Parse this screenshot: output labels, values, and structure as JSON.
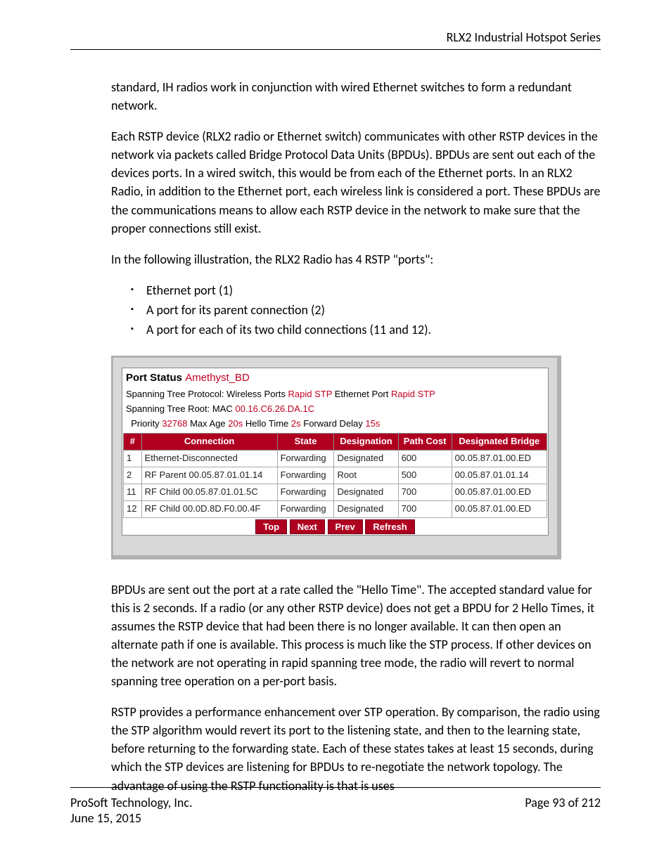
{
  "header": {
    "title": "RLX2 Industrial Hotspot Series"
  },
  "body": {
    "p1": "standard, IH radios work in conjunction with wired Ethernet switches to form a redundant network.",
    "p2": "Each RSTP device (RLX2 radio or Ethernet switch) communicates with other RSTP devices in the network via packets called Bridge Protocol Data Units (BPDUs).  BPDUs are sent out each of the devices ports.  In a wired switch, this would be from each of the Ethernet ports.  In an RLX2 Radio, in addition to the Ethernet port, each wireless link is considered a port.  These BPDUs are the communications means to allow each RSTP device in the network to make sure that the proper connections still exist.",
    "p3": "In the following illustration, the RLX2 Radio has 4 RSTP \"ports\":",
    "bullets": [
      "Ethernet port (1)",
      "A port for its parent connection (2)",
      "A port for each of its two child connections (11 and 12)."
    ],
    "p4": "BPDUs are sent out the port at a rate called the \"Hello Time\". The accepted standard value for this is 2 seconds. If a radio (or any other RSTP device) does not get a BPDU for 2 Hello Times, it assumes the RSTP device that had been there is no longer available. It can then open an alternate path if one is available. This process is much like the STP process. If other devices on the network are not operating in rapid spanning tree mode, the radio will revert to normal spanning tree operation on a per-port basis.",
    "p5": "RSTP provides a performance enhancement over STP operation. By comparison, the radio using the STP algorithm would revert its port to the listening state, and then to the learning state, before returning to the forwarding state. Each of these states takes at least 15 seconds, during which the STP devices are listening for BPDUs to re-negotiate the network topology. The advantage of using the RSTP functionality is that is uses"
  },
  "port_status": {
    "title": "Port Status",
    "device": "Amethyst_BD",
    "line1": {
      "a": "Spanning Tree Protocol: Wireless Ports ",
      "b": "Rapid STP",
      "c": " Ethernet Port ",
      "d": "Rapid STP"
    },
    "line2": {
      "a": "Spanning Tree Root: MAC ",
      "b": "00.16.C6.26.DA.1C"
    },
    "line3": {
      "a": "Priority ",
      "b": "32768",
      "c": " Max Age ",
      "d": "20s",
      "e": " Hello Time ",
      "f": "2s",
      "g": " Forward Delay ",
      "h": "15s"
    },
    "headers": [
      "#",
      "Connection",
      "State",
      "Designation",
      "Path Cost",
      "Designated Bridge"
    ],
    "rows": [
      [
        "1",
        "Ethernet-Disconnected",
        "Forwarding",
        "Designated",
        "600",
        "00.05.87.01.00.ED"
      ],
      [
        "2",
        "RF Parent 00.05.87.01.01.14",
        "Forwarding",
        "Root",
        "500",
        "00.05.87.01.01.14"
      ],
      [
        "11",
        "RF Child 00.05.87.01.01.5C",
        "Forwarding",
        "Designated",
        "700",
        "00.05.87.01.00.ED"
      ],
      [
        "12",
        "RF Child 00.0D.8D.F0.00.4F",
        "Forwarding",
        "Designated",
        "700",
        "00.05.87.01.00.ED"
      ]
    ],
    "buttons": [
      "Top",
      "Next",
      "Prev",
      "Refresh"
    ]
  },
  "footer": {
    "company": "ProSoft Technology, Inc.",
    "date": "June 15, 2015",
    "page": "Page 93 of 212"
  }
}
